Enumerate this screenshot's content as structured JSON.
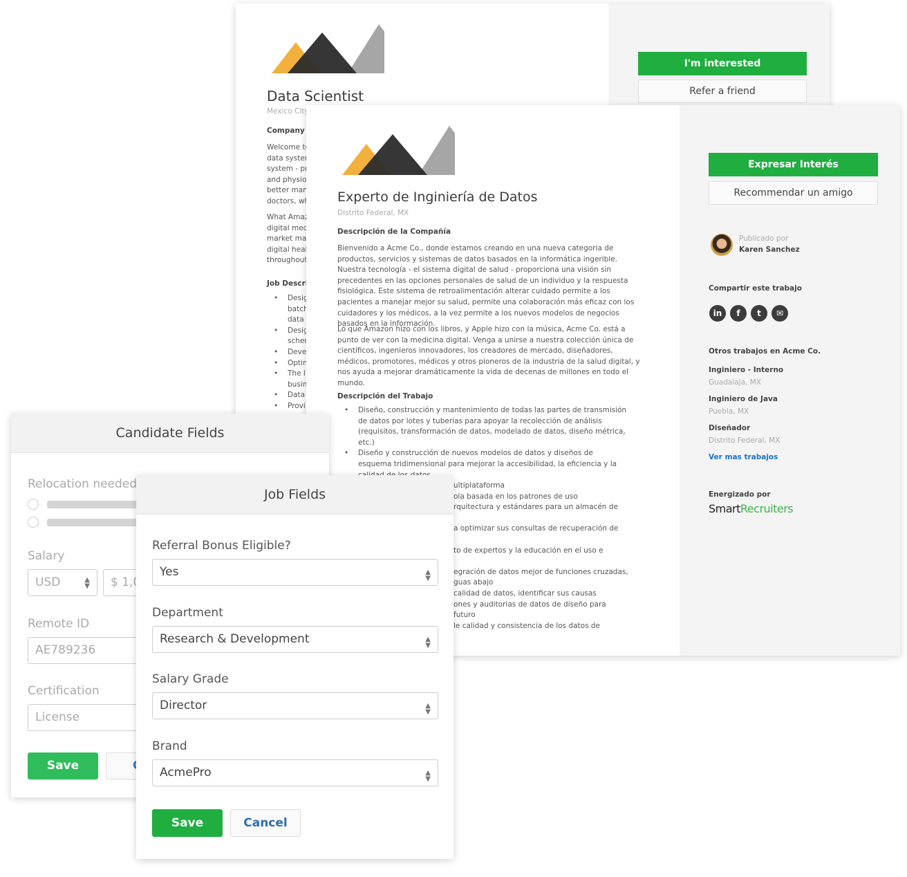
{
  "back_card": {
    "title": "Data Scientist",
    "location": "Mexico City",
    "company_heading": "Company D",
    "para1": [
      "Welcome tc",
      "data systen",
      "system - pr",
      "and physio",
      "better man",
      "doctors, wh"
    ],
    "para2": [
      "What Amaz",
      "digital med",
      "market mal",
      "digital heal",
      "throughout"
    ],
    "job_heading": "Job Descri",
    "bullets": [
      [
        "Desig",
        "batch",
        "data"
      ],
      [
        "Desig",
        "scher"
      ],
      [
        "Devel"
      ],
      [
        "Optin"
      ],
      [
        "The l",
        "busin"
      ],
      [
        "Data"
      ],
      [
        "Provi"
      ]
    ],
    "interested_button": "I'm interested",
    "refer_button": "Refer a friend"
  },
  "front_card": {
    "title": "Experto de Inginiería de Datos",
    "location": "Distrito Federal, MX",
    "company_heading": "Descripción de la Compañía",
    "para1": "Bienvenido a Acme Co., donde estamos creando en una nueva categoria de productos, servicios y sistemas de datos basados en la informática ingerible. Nuestra tecnología - el sistema digital de salud - proporciona una visión sin precedentes en las opciones personales de salud de un individuo y la respuesta fisiológica. Este sistema de retroalimentación alterar cuidado permite a los pacientes a manejar mejor su salud, permite una colaboración más eficaz con los cuidadores y los médicos, a la vez permite a los nuevos modelos de negocios basados en la información.",
    "para2": "Lo que Amazon hizo con los libros, y Apple hizo con la música, Acme Co. está a punto de ver con la medicina digital. Venga a unirse a nuestra colección única de científicos, ingenieros innovadores, los creadores de mercado, diseñadores, médicos, promotores, médicos y otros pioneros de la industria de la salud digital, y nos ayuda a mejorar dramáticamente la vida de decenas de millones en todo el mundo.",
    "job_heading": "Descripción del Trabajo",
    "bullets": [
      "Diseño, construcción y mantenimiento de todas las partes de transmisión de datos por lotes y tuberias para apoyar la recolección de análisis (requisitos, transformación de datos, modelado de datos, diseño métrica, etc.)",
      "Diseño y construcción de nuevos modelos de datos y diseños de esquema tridimensional para mejorar la accesibilidad, la eficiencia y la calidad de los datos"
    ],
    "fragments": [
      "ultiplataforma",
      "ola basada en los patrones de uso",
      "rquitectura y estándares para un almacén de",
      "a optimizar sus consultas de recuperación de",
      "to de expertos y la educación en el uso e",
      "egración de datos mejor de funciones cruzadas,",
      "guas abajo",
      "calidad de datos, identificar sus causas",
      "ones y auditorias de datos de diseño para",
      "futuro",
      "le calidad y consistencia de los datos de"
    ],
    "interest_button": "Expresar Interés",
    "recommend_button": "Recommendar un amigo",
    "published_label": "Publicado por",
    "publisher": "Karen Sanchez",
    "share_heading": "Compartir este trabajo",
    "share_icons": [
      "linkedin-icon",
      "facebook-icon",
      "twitter-icon",
      "email-icon"
    ],
    "other_jobs_heading": "Otros trabajos en Acme Co.",
    "other_jobs": [
      {
        "title": "Inginiero - Interno",
        "location": "Guadalaja, MX"
      },
      {
        "title": "Inginiero de Java",
        "location": "Puebla, MX"
      },
      {
        "title": "Diseñador",
        "location": "Distrito Federal, MX"
      }
    ],
    "more_jobs_link": "Ver mas trabajos",
    "powered_label": "Energizado por",
    "brand_smart": "Smart",
    "brand_recruiters": "Recruiters"
  },
  "candidate_fields": {
    "title": "Candidate Fields",
    "relocation_label": "Relocation needed",
    "salary_label": "Salary",
    "currency": "USD",
    "amount": "$ 1,0",
    "remote_id_label": "Remote ID",
    "remote_id": "AE789236",
    "certification_label": "Certification",
    "certification_placeholder": "License",
    "save": "Save",
    "cancel": "Ca"
  },
  "job_fields": {
    "title": "Job Fields",
    "fields": [
      {
        "label": "Referral Bonus Eligible?",
        "value": "Yes"
      },
      {
        "label": "Department",
        "value": "Research & Development"
      },
      {
        "label": "Salary Grade",
        "value": "Director"
      },
      {
        "label": "Brand",
        "value": "AcmePro"
      }
    ],
    "save": "Save",
    "cancel": "Cancel"
  },
  "colors": {
    "green": "#1fae3f",
    "link": "#1a73c8",
    "logo_orange": "#f1b13c",
    "logo_dark": "#2b2b2b",
    "logo_gray": "#a6a6a6"
  }
}
